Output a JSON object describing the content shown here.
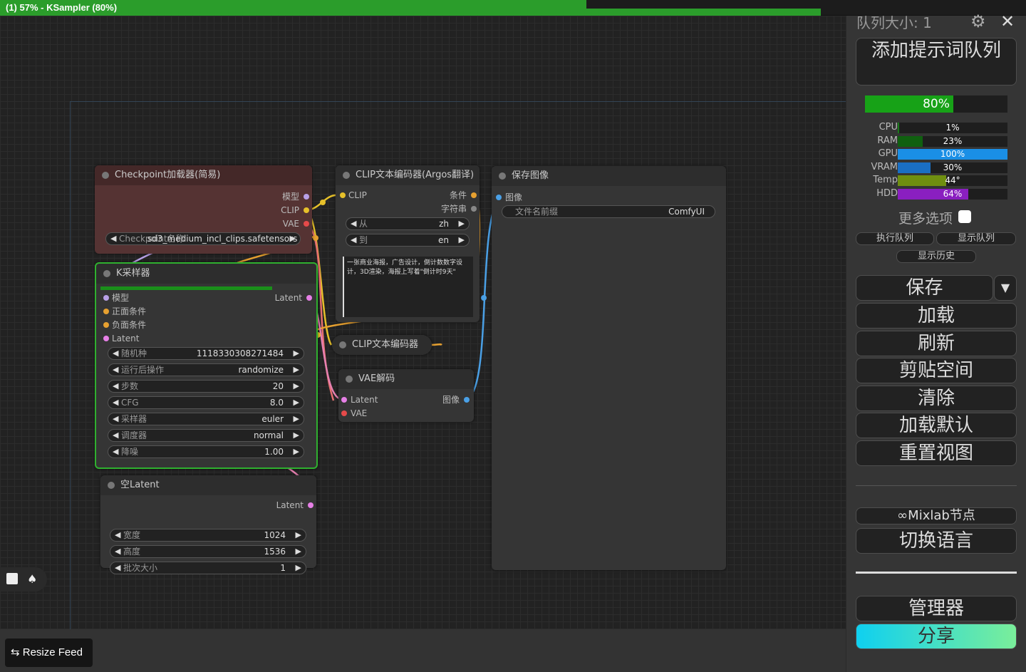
{
  "topbar": {
    "title": "(1) 57% - KSampler (80%)",
    "progress_percent": 57,
    "node_progress_percent": 80
  },
  "nodes": {
    "checkpoint": {
      "title": "Checkpoint加载器(简易)",
      "outputs": [
        "模型",
        "CLIP",
        "VAE"
      ],
      "ckpt_label": "Checkpoint名称",
      "ckpt_value": "sd3_medium_incl_clips.safetensors"
    },
    "ksampler": {
      "title": "K采样器",
      "progress": 0.8,
      "inputs": [
        "模型",
        "正面条件",
        "负面条件",
        "Latent"
      ],
      "output": "Latent",
      "widgets": [
        {
          "label": "随机种",
          "value": "1118330308271484"
        },
        {
          "label": "运行后操作",
          "value": "randomize"
        },
        {
          "label": "步数",
          "value": "20"
        },
        {
          "label": "CFG",
          "value": "8.0"
        },
        {
          "label": "采样器",
          "value": "euler"
        },
        {
          "label": "调度器",
          "value": "normal"
        },
        {
          "label": "降噪",
          "value": "1.00"
        }
      ]
    },
    "empty_latent": {
      "title": "空Latent",
      "output": "Latent",
      "widgets": [
        {
          "label": "宽度",
          "value": "1024"
        },
        {
          "label": "高度",
          "value": "1536"
        },
        {
          "label": "批次大小",
          "value": "1"
        }
      ]
    },
    "clip_argos": {
      "title": "CLIP文本编码器(Argos翻译)",
      "input": "CLIP",
      "outputs": [
        "条件",
        "字符串"
      ],
      "widgets": [
        {
          "label": "从",
          "value": "zh"
        },
        {
          "label": "到",
          "value": "en"
        }
      ],
      "text": "一张商业海报，广告设计，倒计数数字设计，3D渲染，海报上写着\"倒计时9天\""
    },
    "clip_text": {
      "title": "CLIP文本编码器"
    },
    "vae_decode": {
      "title": "VAE解码",
      "inputs": [
        "Latent",
        "VAE"
      ],
      "output": "图像"
    },
    "save_image": {
      "title": "保存图像",
      "input": "图像",
      "prefix_label": "文件名前缀",
      "prefix_value": "ComfyUI"
    }
  },
  "panel": {
    "queue_size": "队列大小: 1",
    "queue_prompt": "添加提示词队列",
    "progress_text": "80%",
    "progress": 0.8,
    "stats": [
      {
        "label": "CPU",
        "text": "1%",
        "value": 0.01,
        "color": "#1a7a1a"
      },
      {
        "label": "RAM",
        "text": "23%",
        "value": 0.23,
        "color": "#106010"
      },
      {
        "label": "GPU",
        "text": "100%",
        "value": 1.0,
        "color": "#1a8fe6"
      },
      {
        "label": "VRAM",
        "text": "30%",
        "value": 0.3,
        "color": "#1a6fc4"
      },
      {
        "label": "Temp",
        "text": "44°",
        "value": 0.44,
        "color": "#6f8f10"
      },
      {
        "label": "HDD",
        "text": "64%",
        "value": 0.64,
        "color": "#8a1fc0"
      }
    ],
    "more_options": "更多选项",
    "view_queue": "执行队列",
    "view_queue2": "显示队列",
    "view_history": "显示历史",
    "save": "保存",
    "load": "加载",
    "refresh": "刷新",
    "clipspace": "剪贴空间",
    "clear": "清除",
    "load_default": "加载默认",
    "reset_view": "重置视图",
    "mixlab": "Mixlab节点",
    "switch_lang": "切换语言",
    "manager": "管理器",
    "share": "分享"
  },
  "resize_feed": "Resize Feed"
}
